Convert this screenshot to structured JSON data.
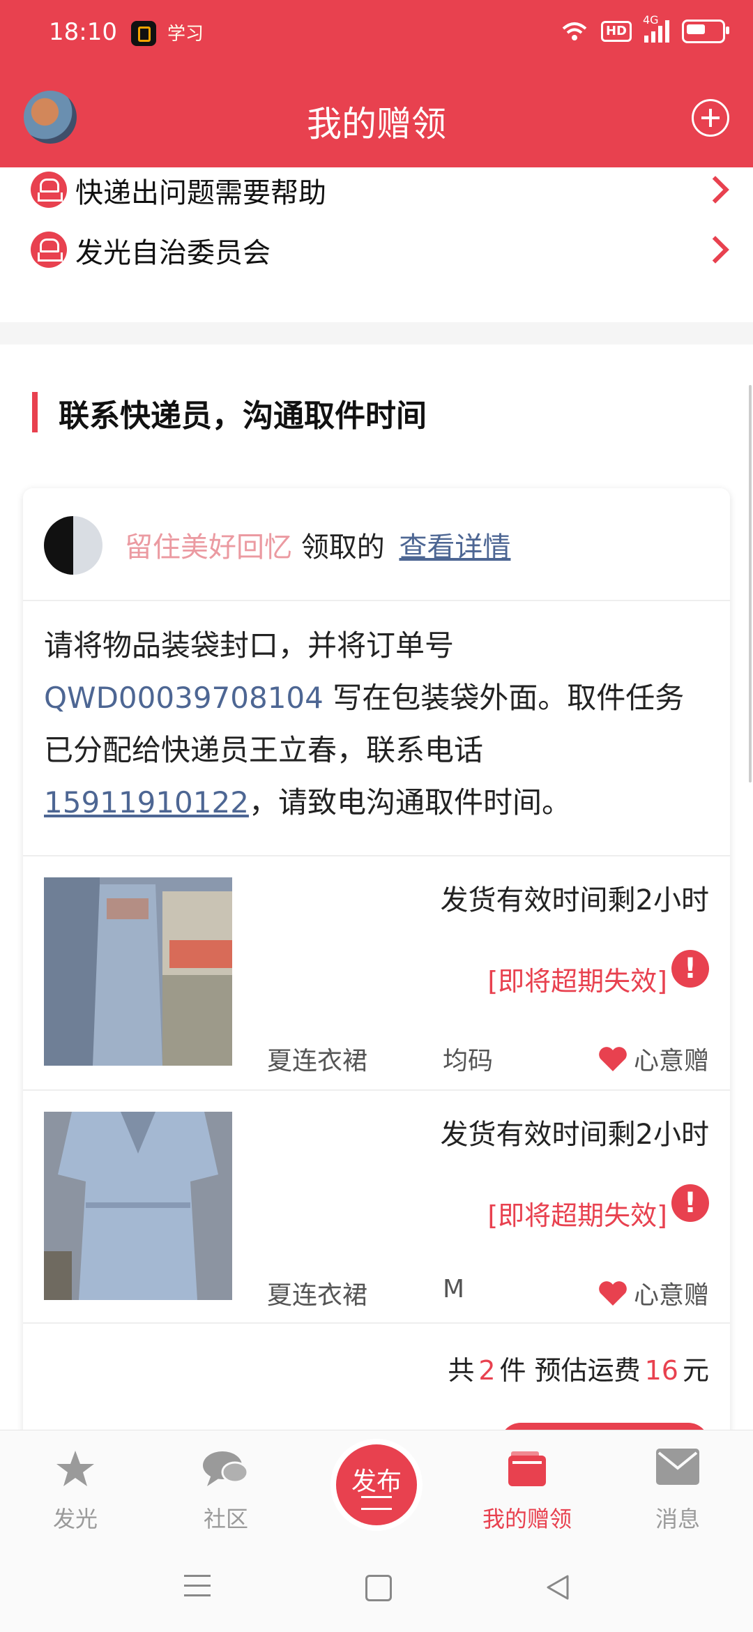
{
  "status_bar": {
    "time": "18:10",
    "app_icon2": "学习",
    "hd": "HD",
    "network": "4G"
  },
  "header": {
    "title": "我的赠领"
  },
  "menu": {
    "items": [
      {
        "label": "快递出问题需要帮助"
      },
      {
        "label": "发光自治委员会"
      }
    ]
  },
  "section": {
    "title": "联系快递员，沟通取件时间"
  },
  "card": {
    "giver_name": "留住美好回忆",
    "action_text": "领取的",
    "view_link": "查看详情",
    "notice_part1": "请将物品装袋封口，并将订单号 ",
    "order_no": "QWD00039708104",
    "notice_part2": " 写在包装袋外面。取件任务已分配给快递员王立春，联系电话",
    "phone": "15911910122",
    "notice_part3": "，请致电沟通取件时间。",
    "items": [
      {
        "expire": "发货有效时间剩2小时",
        "warning": "[即将超期失效]",
        "name": "夏连衣裙",
        "size": "均码",
        "type": "心意赠"
      },
      {
        "expire": "发货有效时间剩2小时",
        "warning": "[即将超期失效]",
        "name": "夏连衣裙",
        "size": "M",
        "type": "心意赠"
      }
    ],
    "summary": {
      "prefix": "共",
      "count": "2",
      "mid": "件 预估运费",
      "fee": "16",
      "suffix": "元"
    }
  },
  "tabs": [
    {
      "label": "发光",
      "icon": "star-icon"
    },
    {
      "label": "社区",
      "icon": "chat-bubbles-icon"
    },
    {
      "label": "发布",
      "icon": "publish-icon"
    },
    {
      "label": "我的赠领",
      "icon": "wallet-icon"
    },
    {
      "label": "消息",
      "icon": "mail-icon"
    }
  ],
  "colors": {
    "brand_red": "#e8414f",
    "link_blue": "#4d6693",
    "giver_pink": "#eb9aa1"
  }
}
